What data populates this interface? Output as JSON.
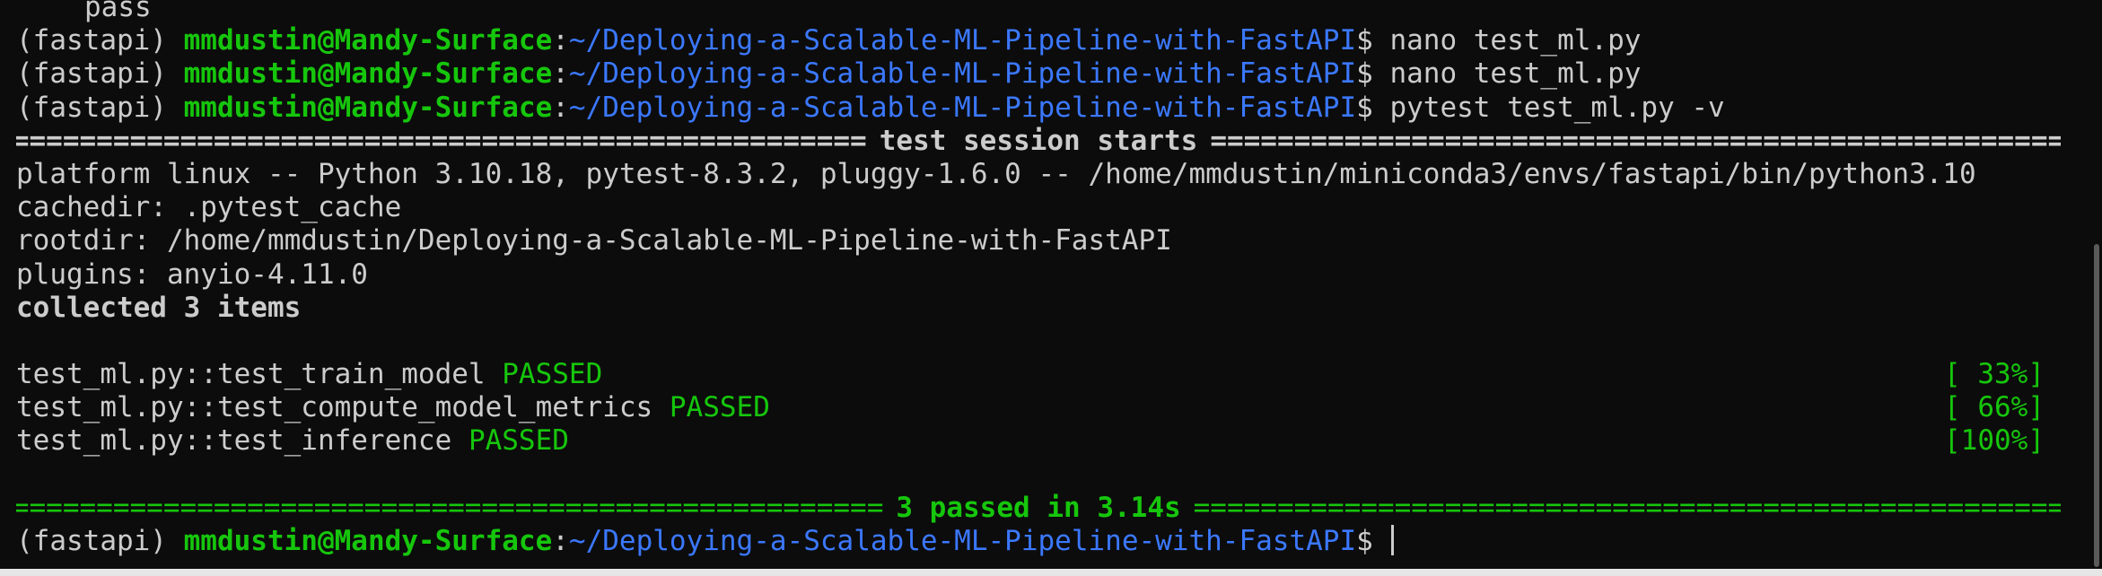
{
  "terminal": {
    "top_line": "pass",
    "prompt": {
      "env": "(fastapi) ",
      "user": "mmdustin@Mandy-Surface",
      "sep": ":",
      "path": "~/Deploying-a-Scalable-ML-Pipeline-with-FastAPI",
      "dollar": "$ "
    },
    "commands": [
      "nano test_ml.py",
      "nano test_ml.py",
      "pytest test_ml.py -v"
    ],
    "rule_char": "====================================================================================================",
    "session_title": "test session starts",
    "info_lines": [
      "platform linux -- Python 3.10.18, pytest-8.3.2, pluggy-1.6.0 -- /home/mmdustin/miniconda3/envs/fastapi/bin/python3.10",
      "cachedir: .pytest_cache",
      "rootdir: /home/mmdustin/Deploying-a-Scalable-ML-Pipeline-with-FastAPI",
      "plugins: anyio-4.11.0"
    ],
    "collected": "collected 3 items",
    "results": [
      {
        "test": "test_ml.py::test_train_model",
        "status": "PASSED",
        "progress": "[ 33%]"
      },
      {
        "test": "test_ml.py::test_compute_model_metrics",
        "status": "PASSED",
        "progress": "[ 66%]"
      },
      {
        "test": "test_ml.py::test_inference",
        "status": "PASSED",
        "progress": "[100%]"
      }
    ],
    "summary": "3 passed in 3.14s",
    "colors": {
      "background": "#0c0c0c",
      "foreground": "#cccccc",
      "user_green": "#16c60c",
      "path_blue": "#3b78ff",
      "passed_green": "#16c60c"
    }
  }
}
